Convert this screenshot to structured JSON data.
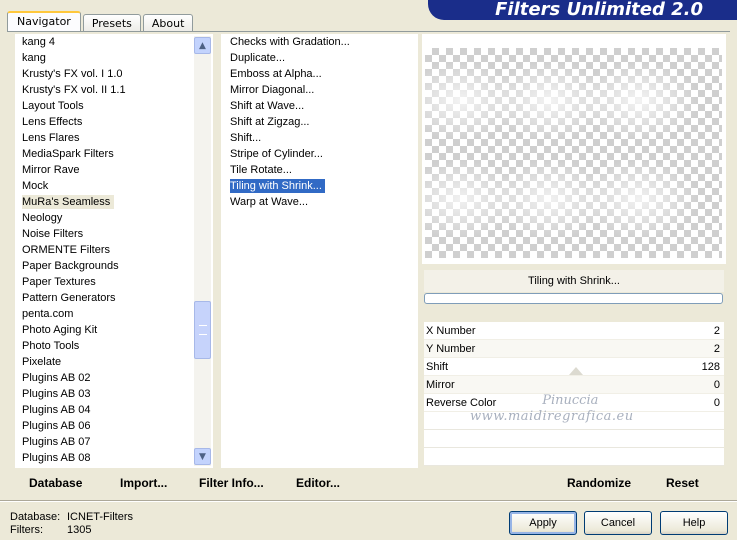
{
  "header": {
    "title": "Filters Unlimited 2.0"
  },
  "tabs": [
    {
      "label": "Navigator",
      "active": true
    },
    {
      "label": "Presets",
      "active": false
    },
    {
      "label": "About",
      "active": false
    }
  ],
  "categories": [
    "kang 4",
    "kang",
    "Krusty's FX vol. I 1.0",
    "Krusty's FX vol. II 1.1",
    "Layout Tools",
    "Lens Effects",
    "Lens Flares",
    "MediaSpark Filters",
    "Mirror Rave",
    "Mock",
    "MuRa's Seamless",
    "Neology",
    "Noise Filters",
    "ORMENTE Filters",
    "Paper Backgrounds",
    "Paper Textures",
    "Pattern Generators",
    "penta.com",
    "Photo Aging Kit",
    "Photo Tools",
    "Pixelate",
    "Plugins AB 02",
    "Plugins AB 03",
    "Plugins AB 04",
    "Plugins AB 06",
    "Plugins AB 07",
    "Plugins AB 08"
  ],
  "selected_category": "MuRa's Seamless",
  "filters": [
    "Checks with Gradation...",
    "Duplicate...",
    "Emboss at Alpha...",
    "Mirror Diagonal...",
    "Shift at Wave...",
    "Shift at Zigzag...",
    "Shift...",
    "Stripe of Cylinder...",
    "Tile Rotate...",
    "Tiling with Shrink...",
    "Warp at Wave..."
  ],
  "selected_filter": "Tiling with Shrink...",
  "filter_name": "Tiling with Shrink...",
  "progress": 0,
  "params": [
    {
      "label": "X Number",
      "value": "2"
    },
    {
      "label": "Y Number",
      "value": "2"
    },
    {
      "label": "Shift",
      "value": "128"
    },
    {
      "label": "Mirror",
      "value": "0"
    },
    {
      "label": "Reverse Color",
      "value": "0"
    }
  ],
  "watermark": {
    "line1": "Pinuccia",
    "line2": "www.maidiregrafica.eu"
  },
  "toolbar": {
    "database": "Database",
    "import": "Import...",
    "filter_info": "Filter Info...",
    "editor": "Editor...",
    "randomize": "Randomize",
    "reset": "Reset"
  },
  "status": {
    "database_label": "Database:",
    "database_value": "ICNET-Filters",
    "filters_label": "Filters:",
    "filters_value": "1305"
  },
  "buttons": {
    "apply": "Apply",
    "cancel": "Cancel",
    "help": "Help"
  },
  "colors": {
    "banner": "#1a2d8a",
    "selection": "#316ac5",
    "accent_tab": "#ffc83c"
  },
  "icons": {
    "scroll_up": "▲",
    "scroll_down": "▼"
  }
}
